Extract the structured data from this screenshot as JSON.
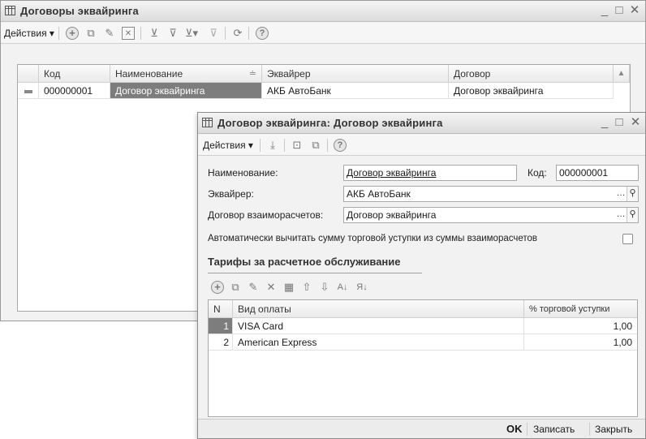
{
  "main_window": {
    "title": "Договоры эквайринга",
    "toolbar": {
      "actions_label": "Действия"
    },
    "columns": [
      "Код",
      "Наименование",
      "Эквайрер",
      "Договор"
    ],
    "rows": [
      {
        "code": "000000001",
        "name": "Договор эквайринга",
        "acquirer": "АКБ АвтоБанк",
        "contract": "Договор эквайринга"
      }
    ]
  },
  "form_window": {
    "title": "Договор эквайринга: Договор эквайринга",
    "toolbar": {
      "actions_label": "Действия"
    },
    "fields": {
      "name_label": "Наименование:",
      "name_value": "Договор эквайринга",
      "code_label": "Код:",
      "code_value": "000000001",
      "acquirer_label": "Эквайрер:",
      "acquirer_value": "АКБ АвтоБанк",
      "settlement_label": "Договор взаиморасчетов:",
      "settlement_value": "Договор эквайринга",
      "autodeduct_label": "Автоматически вычитать сумму торговой уступки из суммы взаиморасчетов"
    },
    "tariffs": {
      "section_title": "Тарифы за расчетное обслуживание",
      "columns": [
        "N",
        "Вид оплаты",
        "% торговой уступки"
      ],
      "rows": [
        {
          "n": "1",
          "payment_type": "VISA Card",
          "discount": "1,00"
        },
        {
          "n": "2",
          "payment_type": "American Express",
          "discount": "1,00"
        }
      ]
    },
    "buttons": {
      "ok": "OK",
      "save": "Записать",
      "close": "Закрыть"
    }
  }
}
